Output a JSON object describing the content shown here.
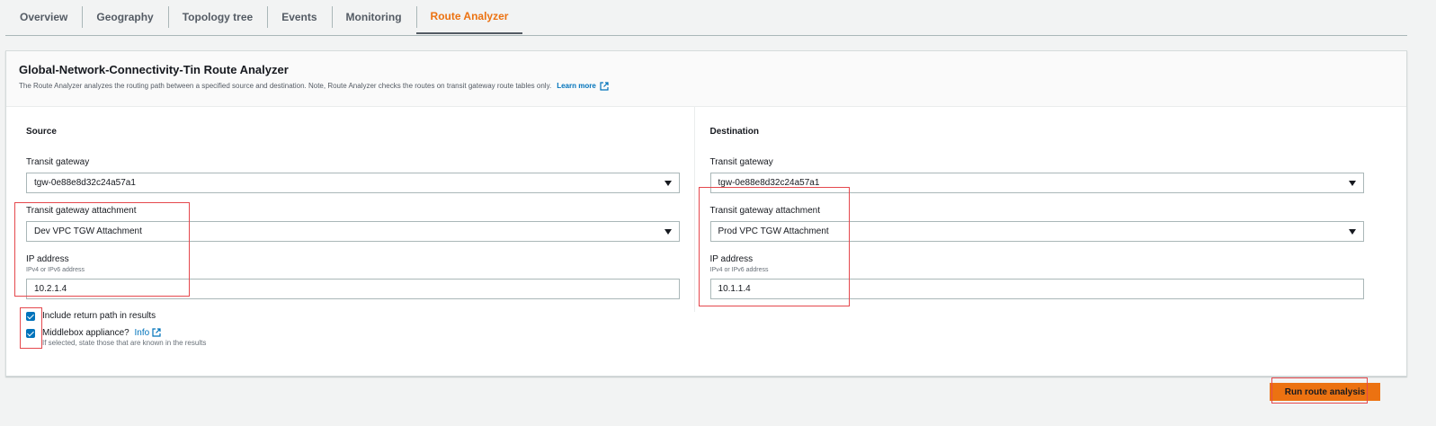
{
  "tabs": [
    {
      "label": "Overview"
    },
    {
      "label": "Geography"
    },
    {
      "label": "Topology tree"
    },
    {
      "label": "Events"
    },
    {
      "label": "Monitoring"
    },
    {
      "label": "Route Analyzer"
    }
  ],
  "active_tab": "Route Analyzer",
  "card": {
    "title": "Global-Network-Connectivity-Tin Route Analyzer",
    "description": "The Route Analyzer analyzes the routing path between a specified source and destination. Note, Route Analyzer checks the routes on transit gateway route tables only.",
    "learn_more": "Learn more"
  },
  "source": {
    "title": "Source",
    "transit_gateway_label": "Transit gateway",
    "transit_gateway_value": "tgw-0e88e8d32c24a57a1",
    "attachment_label": "Transit gateway attachment",
    "attachment_value": "Dev VPC TGW Attachment",
    "ip_label": "IP address",
    "ip_hint": "IPv4 or IPv6 address",
    "ip_value": "10.2.1.4"
  },
  "destination": {
    "title": "Destination",
    "transit_gateway_label": "Transit gateway",
    "transit_gateway_value": "tgw-0e88e8d32c24a57a1",
    "attachment_label": "Transit gateway attachment",
    "attachment_value": "Prod VPC TGW Attachment",
    "ip_label": "IP address",
    "ip_hint": "IPv4 or IPv6 address",
    "ip_value": "10.1.1.4"
  },
  "options": {
    "return_path_label": "Include return path in results",
    "return_path_checked": true,
    "middlebox_label": "Middlebox appliance?",
    "middlebox_info": "Info",
    "middlebox_help": "If selected, state those that are known in the results",
    "middlebox_checked": true
  },
  "run_button": "Run route analysis",
  "colors": {
    "accent": "#ec7211",
    "link": "#0073bb",
    "highlight": "#e5484d"
  }
}
